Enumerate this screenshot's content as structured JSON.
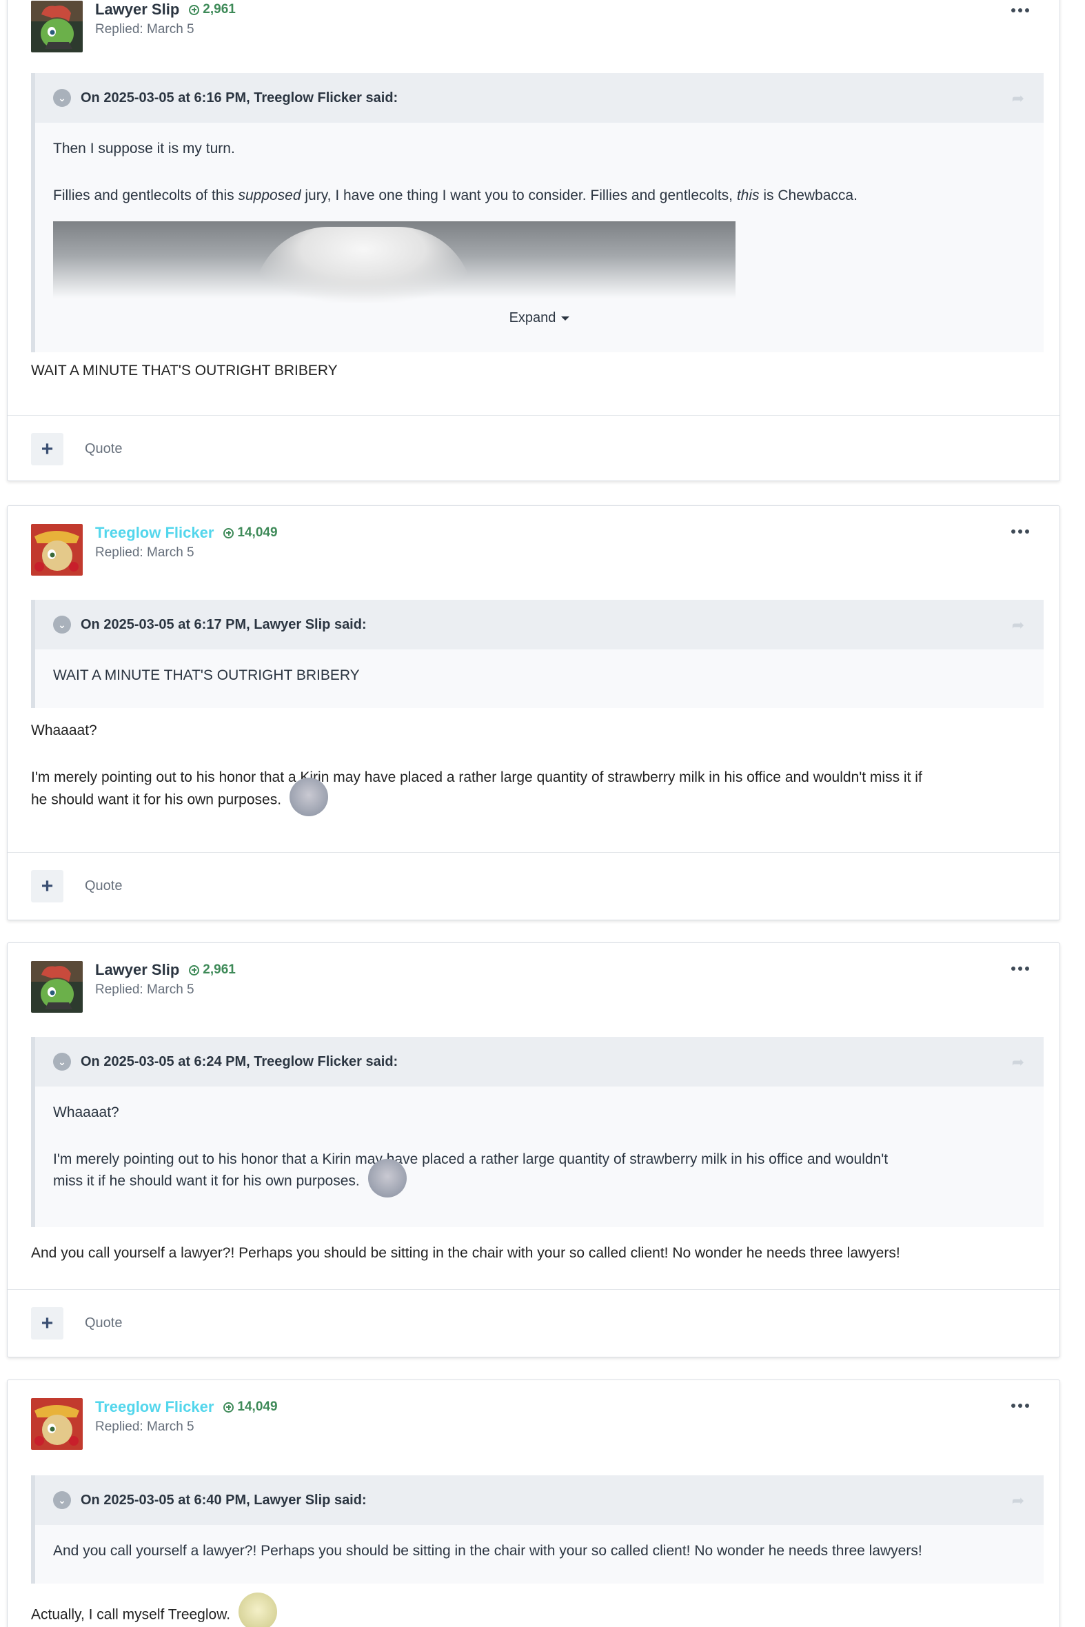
{
  "posts": [
    {
      "author": "Lawyer Slip",
      "reputation": "2,961",
      "replied": "Replied: March 5",
      "quote": {
        "cite": "On 2025-03-05 at 6:16 PM, Treeglow Flicker said:",
        "p1": "Then I suppose it is my turn.",
        "p2_a": "Fillies and gentlecolts of this ",
        "p2_em1": "supposed",
        "p2_b": " jury, I have one thing I want you to consider. Fillies and gentlecolts, ",
        "p2_em2": "this",
        "p2_c": " is Chewbacca.",
        "expand": "Expand"
      },
      "body": [
        "WAIT A MINUTE THAT'S OUTRIGHT BRIBERY"
      ],
      "quote_label": "Quote"
    },
    {
      "author": "Treeglow Flicker",
      "reputation": "14,049",
      "replied": "Replied: March 5",
      "quote": {
        "cite": "On 2025-03-05 at 6:17 PM, Lawyer Slip said:",
        "p1": "WAIT A MINUTE THAT'S OUTRIGHT BRIBERY"
      },
      "body": [
        "Whaaaat?",
        "I'm merely pointing out to his honor that a Kirin may have placed a rather large quantity of strawberry milk in his office and wouldn't miss it if",
        "he should want it for his own purposes."
      ],
      "quote_label": "Quote"
    },
    {
      "author": "Lawyer Slip",
      "reputation": "2,961",
      "replied": "Replied: March 5",
      "quote": {
        "cite": "On 2025-03-05 at 6:24 PM, Treeglow Flicker said:",
        "p1": "Whaaaat?",
        "p2": "I'm merely pointing out to his honor that a Kirin may have placed a rather large quantity of strawberry milk in his office and wouldn't",
        "p3": "miss it if he should want it for his own purposes."
      },
      "body": [
        "And you call yourself a lawyer?! Perhaps you should be sitting in the chair with your so called client! No wonder he needs three lawyers!"
      ],
      "quote_label": "Quote"
    },
    {
      "author": "Treeglow Flicker",
      "reputation": "14,049",
      "replied": "Replied: March 5",
      "quote": {
        "cite": "On 2025-03-05 at 6:40 PM, Lawyer Slip said:",
        "p1": "And you call yourself a lawyer?! Perhaps you should be sitting in the chair with your so called client! No wonder he needs three lawyers!"
      },
      "body": [
        "Actually, I call myself Treeglow."
      ]
    }
  ],
  "colors": {
    "author_default": "#2b3541",
    "author_treeglow": "#53d6ec",
    "reputation": "#3e8a58",
    "quote_bg": "#f8f9fb",
    "cite_bg": "#ebeef2"
  },
  "icons": {
    "more": "ellipsis-icon",
    "collapse": "chevron-down-icon",
    "share": "share-arrow-icon",
    "add": "plus-icon",
    "rep": "plus-circle-icon"
  }
}
